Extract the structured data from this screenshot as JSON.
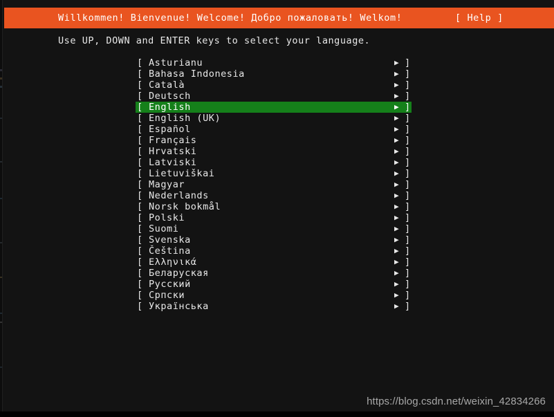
{
  "header": {
    "title": "Willkommen! Bienvenue! Welcome! Добро пожаловать! Welkom!",
    "help_label": "[ Help ]",
    "bar_color": "#e95420"
  },
  "instruction": {
    "text": "Use UP, DOWN and ENTER keys to select your language."
  },
  "list": {
    "bracket_open": "[",
    "bracket_close": "]",
    "arrow_icon": "▶",
    "selected_color": "#15801a",
    "selected_index": 4,
    "items": [
      {
        "label": "Asturianu"
      },
      {
        "label": "Bahasa Indonesia"
      },
      {
        "label": "Català"
      },
      {
        "label": "Deutsch"
      },
      {
        "label": "English"
      },
      {
        "label": "English (UK)"
      },
      {
        "label": "Español"
      },
      {
        "label": "Français"
      },
      {
        "label": "Hrvatski"
      },
      {
        "label": "Latviski"
      },
      {
        "label": "Lietuviškai"
      },
      {
        "label": "Magyar"
      },
      {
        "label": "Nederlands"
      },
      {
        "label": "Norsk bokmål"
      },
      {
        "label": "Polski"
      },
      {
        "label": "Suomi"
      },
      {
        "label": "Svenska"
      },
      {
        "label": "Čeština"
      },
      {
        "label": "Ελληνικά"
      },
      {
        "label": "Беларуская"
      },
      {
        "label": "Русский"
      },
      {
        "label": "Српски"
      },
      {
        "label": "Українська"
      }
    ]
  },
  "watermark": {
    "text": "https://blog.csdn.net/weixin_42834266"
  }
}
